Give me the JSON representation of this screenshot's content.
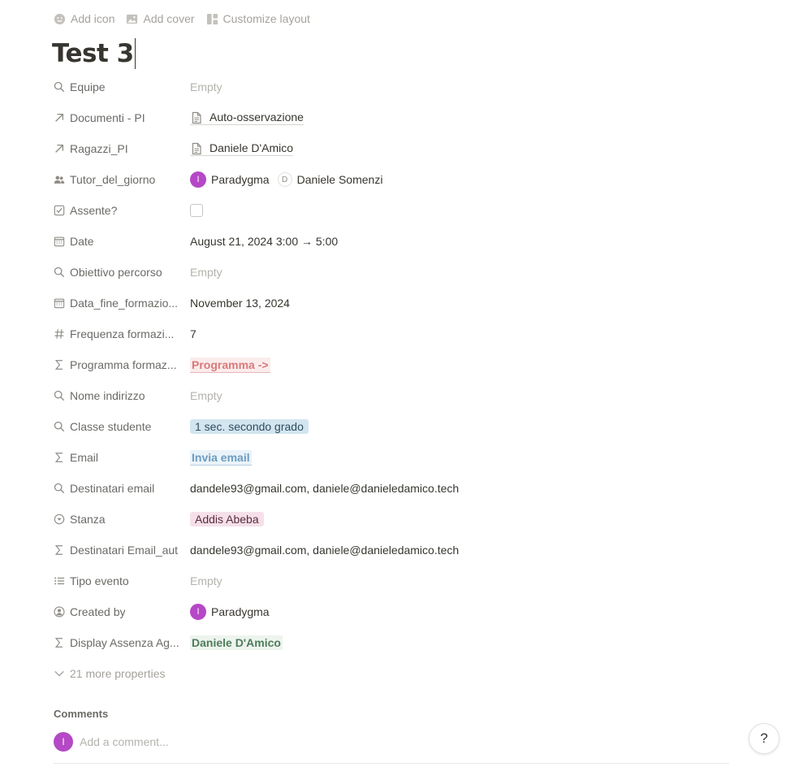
{
  "topbar": {
    "add_icon": "Add icon",
    "add_cover": "Add cover",
    "customize_layout": "Customize layout"
  },
  "page": {
    "title": "Test 3"
  },
  "properties": {
    "equipe": {
      "label": "Equipe",
      "value": "Empty"
    },
    "documenti": {
      "label": "Documenti - PI",
      "value": "Auto-osservazione"
    },
    "ragazzi": {
      "label": "Ragazzi_PI",
      "value": "Daniele D'Amico"
    },
    "tutor": {
      "label": "Tutor_del_giorno",
      "person1": "Paradygma",
      "person1_initial": "I",
      "person2": "Daniele Somenzi",
      "person2_initial": "D"
    },
    "assente": {
      "label": "Assente?",
      "checked": false
    },
    "date": {
      "label": "Date",
      "value": "August 21, 2024 3:00 → 5:00"
    },
    "obiettivo": {
      "label": "Obiettivo percorso",
      "value": "Empty"
    },
    "data_fine": {
      "label": "Data_fine_formazio...",
      "value": "November 13, 2024"
    },
    "frequenza": {
      "label": "Frequenza formazi...",
      "value": "7"
    },
    "programma": {
      "label": "Programma formaz...",
      "value": "Programma ->"
    },
    "nome_indirizzo": {
      "label": "Nome indirizzo",
      "value": "Empty"
    },
    "classe": {
      "label": "Classe studente",
      "value": "1 sec. secondo grado"
    },
    "email": {
      "label": "Email",
      "value": "Invia email"
    },
    "destinatari": {
      "label": "Destinatari email",
      "value": "dandele93@gmail.com, daniele@danieledamico.tech"
    },
    "stanza": {
      "label": "Stanza",
      "value": "Addis Abeba"
    },
    "destinatari_aut": {
      "label": "Destinatari Email_aut",
      "value": "dandele93@gmail.com, daniele@danieledamico.tech"
    },
    "tipo_evento": {
      "label": "Tipo evento",
      "value": "Empty"
    },
    "created_by": {
      "label": "Created by",
      "value": "Paradygma",
      "initial": "I"
    },
    "display_assenza": {
      "label": "Display Assenza Ag...",
      "value": "Daniele D'Amico"
    }
  },
  "more_properties": "21 more properties",
  "comments": {
    "label": "Comments",
    "placeholder": "Add a comment...",
    "avatar_initial": "I"
  },
  "help": {
    "label": "?"
  },
  "colors": {
    "avatar": "#b548c6",
    "formula_red": "#d9797a",
    "formula_blue": "#6c9cc1",
    "formula_green": "#4e7c5b",
    "tag_blue_bg": "#d3e5ef",
    "tag_pink_bg": "#f5e0e9"
  },
  "icons": {
    "equipe": "search-icon",
    "documenti": "arrow-up-right-icon",
    "ragazzi": "arrow-up-right-icon",
    "tutor": "people-icon",
    "assente": "checkbox-icon",
    "date": "calendar-icon",
    "obiettivo": "search-icon",
    "data_fine": "calendar-icon",
    "frequenza": "hash-icon",
    "programma": "sigma-icon",
    "nome_indirizzo": "search-icon",
    "classe": "search-icon",
    "email": "sigma-icon",
    "destinatari": "search-icon",
    "stanza": "select-icon",
    "destinatari_aut": "sigma-icon",
    "tipo_evento": "list-icon",
    "created_by": "user-circle-icon",
    "display_assenza": "sigma-icon"
  }
}
